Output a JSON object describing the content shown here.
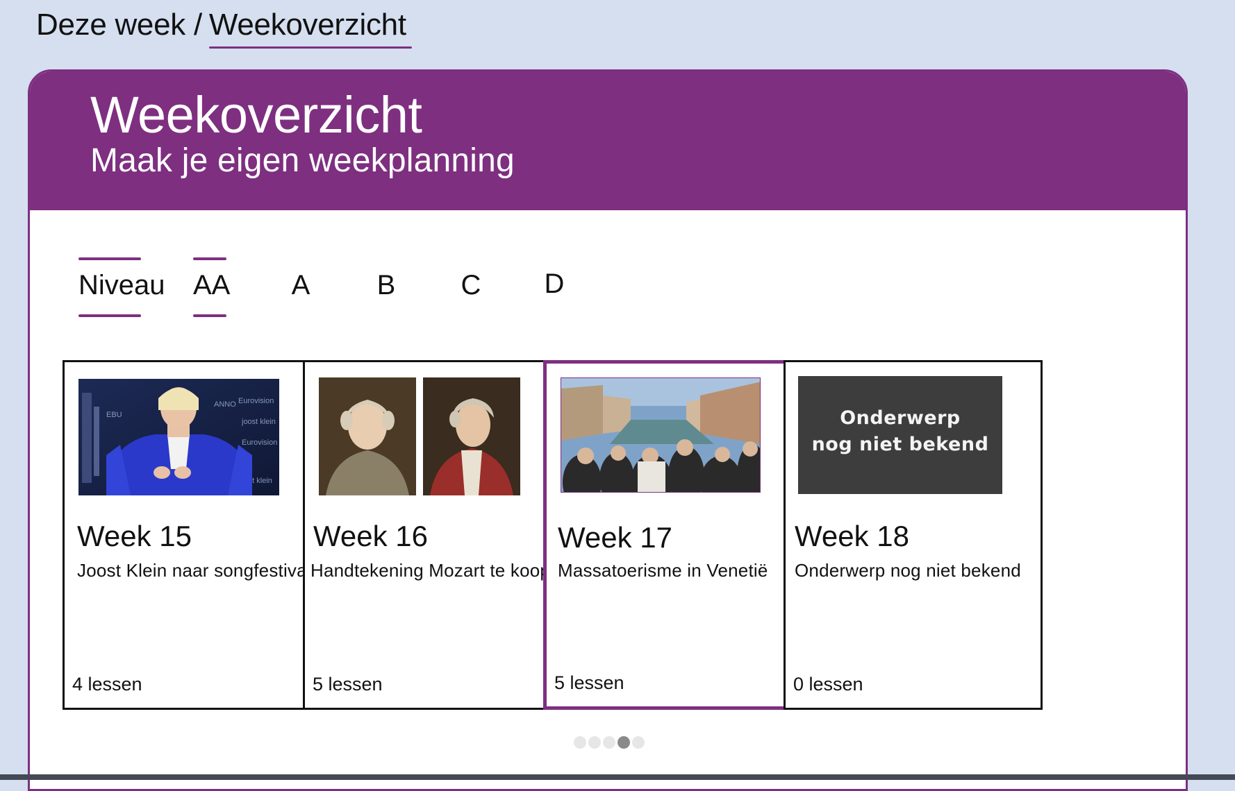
{
  "breadcrumb": {
    "parent": "Deze week",
    "separator": "/",
    "current": "Weekoverzicht"
  },
  "header": {
    "title": "Weekoverzicht",
    "subtitle": "Maak je eigen weekplanning"
  },
  "levels": {
    "label": "Niveau",
    "options": [
      "AA",
      "A",
      "B",
      "C",
      "D"
    ],
    "selected": "AA"
  },
  "cards": [
    {
      "week": "Week 15",
      "topic": "Joost Klein naar songfestival",
      "lessons": "4 lessen",
      "image": "photo-artist-blue-suit",
      "selected": false
    },
    {
      "week": "Week 16",
      "topic": "Handtekening Mozart te koop",
      "lessons": "5 lessen",
      "image": "portraits-mozart",
      "selected": false
    },
    {
      "week": "Week 17",
      "topic": "Massatoerisme in Venetië",
      "lessons": "5 lessen",
      "image": "photo-venice-crowd",
      "selected": true
    },
    {
      "week": "Week 18",
      "topic": "Onderwerp nog niet bekend",
      "lessons": "0 lessen",
      "image": "chalkboard",
      "image_text": [
        "Onderwerp",
        "nog niet bekend"
      ],
      "selected": false
    }
  ],
  "pager": {
    "total": 5,
    "active_index": 3
  },
  "colors": {
    "accent": "#7e2f80",
    "background": "#d5dff0",
    "card_border": "#111111",
    "chalkboard": "#3a3a3a"
  }
}
